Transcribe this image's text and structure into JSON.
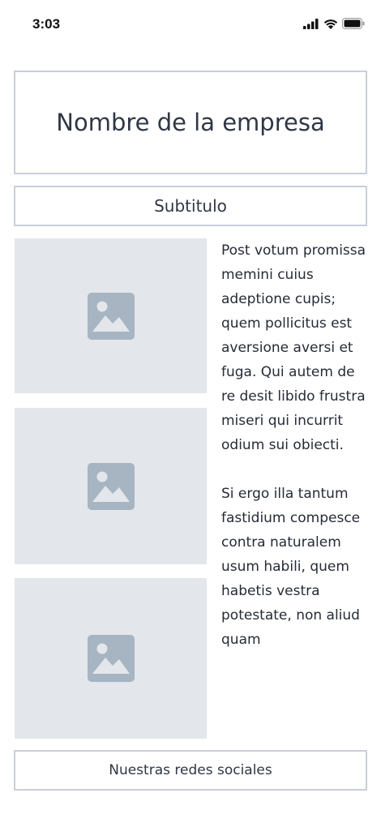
{
  "status_bar": {
    "time": "3:03",
    "icons": [
      "signal-icon",
      "wifi-icon",
      "battery-icon"
    ]
  },
  "header": {
    "company_name": "Nombre de la empresa",
    "subtitle": "Subtitulo"
  },
  "content": {
    "images": [
      "image-placeholder-icon",
      "image-placeholder-icon",
      "image-placeholder-icon"
    ],
    "paragraphs": [
      "Post votum promissa memini cuius adeptione cupis; quem pollicitus est aversione aversi et fuga. Qui autem de re desit libido frustra miseri qui incurrit odium sui obiecti.",
      "Si ergo illa tantum fastidium compesce contra naturalem usum habili, quem habetis vestra potestate, non aliud quam"
    ]
  },
  "footer": {
    "social_label": "Nuestras redes sociales"
  },
  "colors": {
    "border": "#c7d0da",
    "placeholder_bg": "#e3e6ea",
    "placeholder_icon": "#a7b4c2",
    "text": "#2f3645"
  }
}
